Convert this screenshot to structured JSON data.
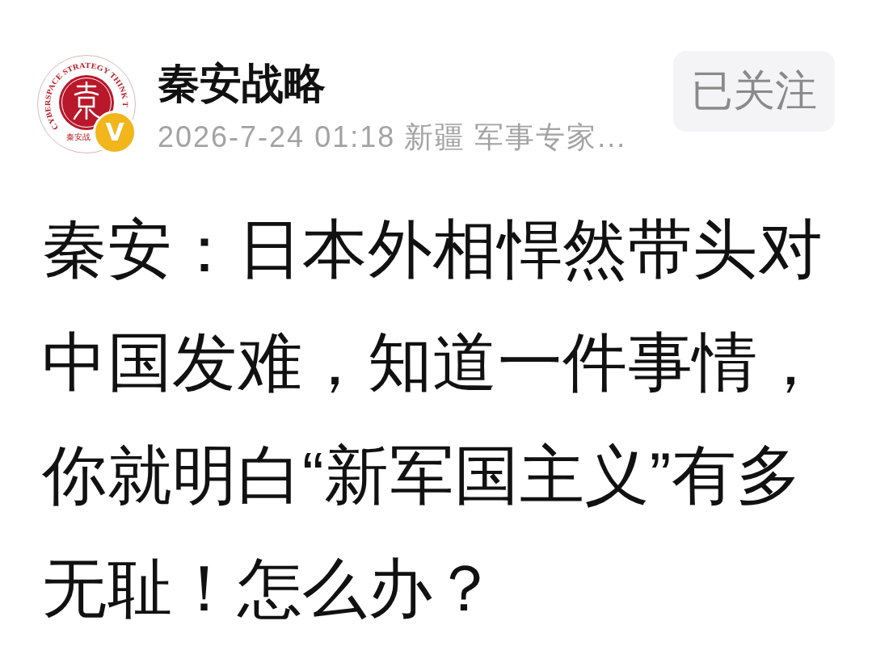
{
  "author": {
    "avatar": {
      "ring_text": "CYBERSPACE STRATEGY THINK T",
      "caption": "秦安战"
    },
    "verified_badge": "V",
    "name": "秦安战略",
    "time": "2026-7-24 01:18",
    "location": "新疆",
    "description": "军事专家..."
  },
  "follow_button": {
    "label": "已关注",
    "followed": true
  },
  "title": "秦安：日本外相悍然带头对中国发难，知道一件事情，你就明白“新军国主义”有多无耻！怎么办？"
}
